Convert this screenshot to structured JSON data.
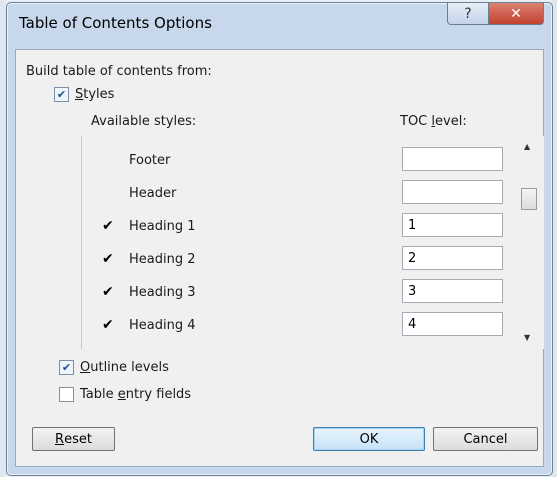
{
  "dialog": {
    "title": "Table of Contents Options",
    "help_glyph": "?",
    "close_glyph": "✕"
  },
  "build_from": {
    "label": "Build table of contents from:",
    "styles": {
      "label_acc": "S",
      "label_rest": "tyles",
      "checked": true
    },
    "available_styles_header": "Available styles:",
    "toc_level_header_pre": "TOC ",
    "toc_level_header_acc": "l",
    "toc_level_header_post": "evel:",
    "rows": [
      {
        "mark": "",
        "name": "Footer",
        "level": ""
      },
      {
        "mark": "",
        "name": "Header",
        "level": ""
      },
      {
        "mark": "✔",
        "name": "Heading 1",
        "level": "1"
      },
      {
        "mark": "✔",
        "name": "Heading 2",
        "level": "2"
      },
      {
        "mark": "✔",
        "name": "Heading 3",
        "level": "3"
      },
      {
        "mark": "✔",
        "name": "Heading 4",
        "level": "4"
      }
    ],
    "outline_levels": {
      "label_acc": "O",
      "label_rest": "utline levels",
      "checked": true
    },
    "table_entry_fields": {
      "label_pre": "Table ",
      "label_acc": "e",
      "label_rest": "ntry fields",
      "checked": false
    }
  },
  "buttons": {
    "reset_acc": "R",
    "reset_rest": "eset",
    "ok": "OK",
    "cancel": "Cancel"
  },
  "scrollbar": {
    "up_glyph": "▲",
    "down_glyph": "▼"
  },
  "colors": {
    "frame": "#c7d8ed",
    "close_button": "#c3422f",
    "client": "#f0f0f0",
    "default_button": "#c6e1f7"
  }
}
